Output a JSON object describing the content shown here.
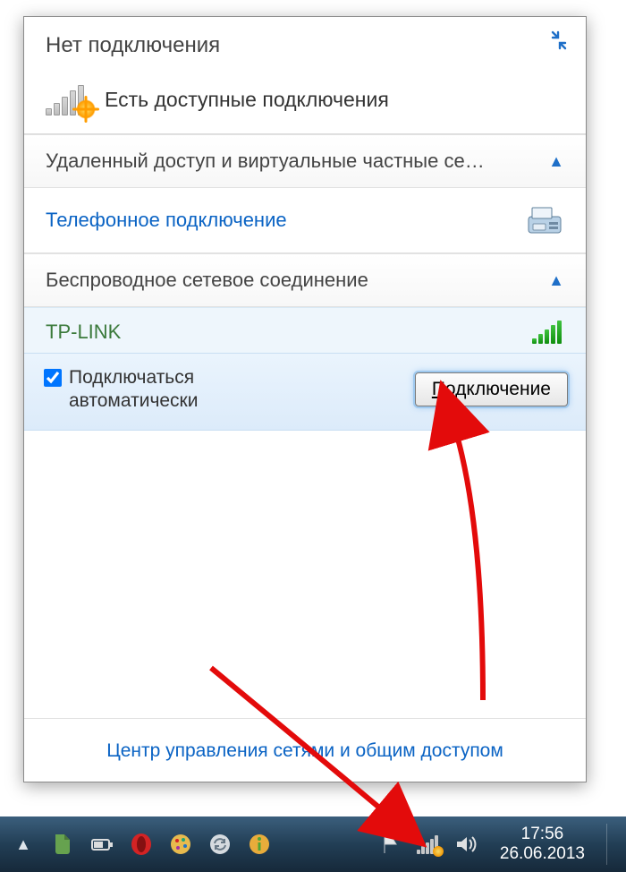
{
  "popup": {
    "title": "Нет подключения",
    "available_text": "Есть доступные подключения",
    "categories": {
      "vpn": "Удаленный доступ и виртуальные частные се…",
      "wireless": "Беспроводное сетевое соединение"
    },
    "dialup_label": "Телефонное подключение",
    "ssid": "TP-LINK",
    "auto_connect_label": "Подключаться\nавтоматически",
    "auto_connect_checked": true,
    "connect_button_char": "П",
    "connect_button_rest": "одключение",
    "footer_link": "Центр управления сетями и общим доступом"
  },
  "taskbar": {
    "time": "17:56",
    "date": "26.06.2013"
  },
  "colors": {
    "link": "#0a63c4",
    "accent": "#1e6fc8",
    "annotation": "#e30b0b"
  }
}
